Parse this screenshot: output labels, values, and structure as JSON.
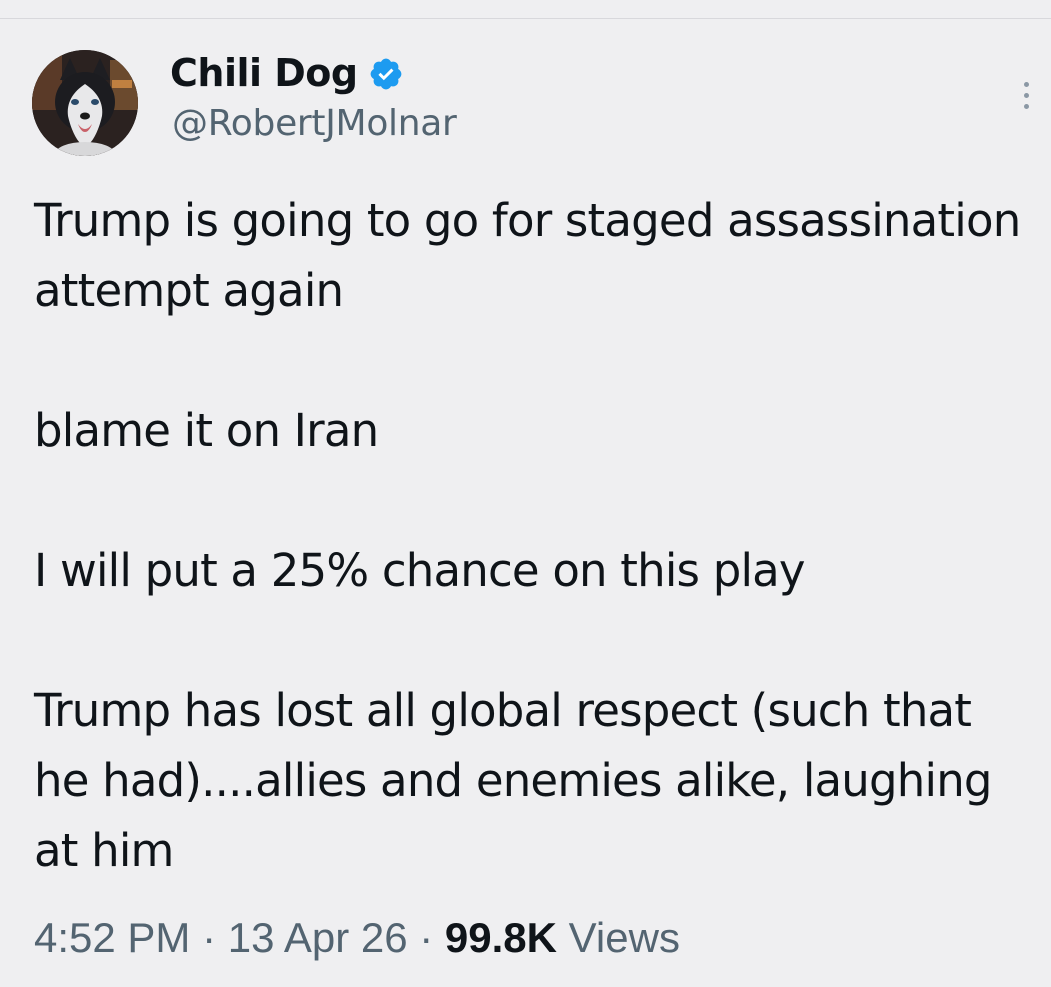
{
  "author": {
    "display_name": "Chili Dog",
    "handle": "@RobertJMolnar",
    "verified_icon": "verified-badge-icon",
    "avatar_icon": "husky-avatar"
  },
  "tweet": {
    "paragraphs": [
      "Trump is going to go for staged assassination attempt again",
      "blame it on Iran",
      "I will put a 25% chance on this play",
      "Trump has lost all global respect (such that he had)....allies and enemies alike, laughing at him"
    ]
  },
  "meta": {
    "time": "4:52 PM",
    "separator": "·",
    "date": "13 Apr 26",
    "views_count": "99.8K",
    "views_label": "Views"
  },
  "colors": {
    "background": "#efeff1",
    "text_primary": "#0f1419",
    "text_secondary": "#536471",
    "verified_blue": "#1d9bf0"
  },
  "menu": {
    "more_icon": "more-vertical-icon"
  }
}
